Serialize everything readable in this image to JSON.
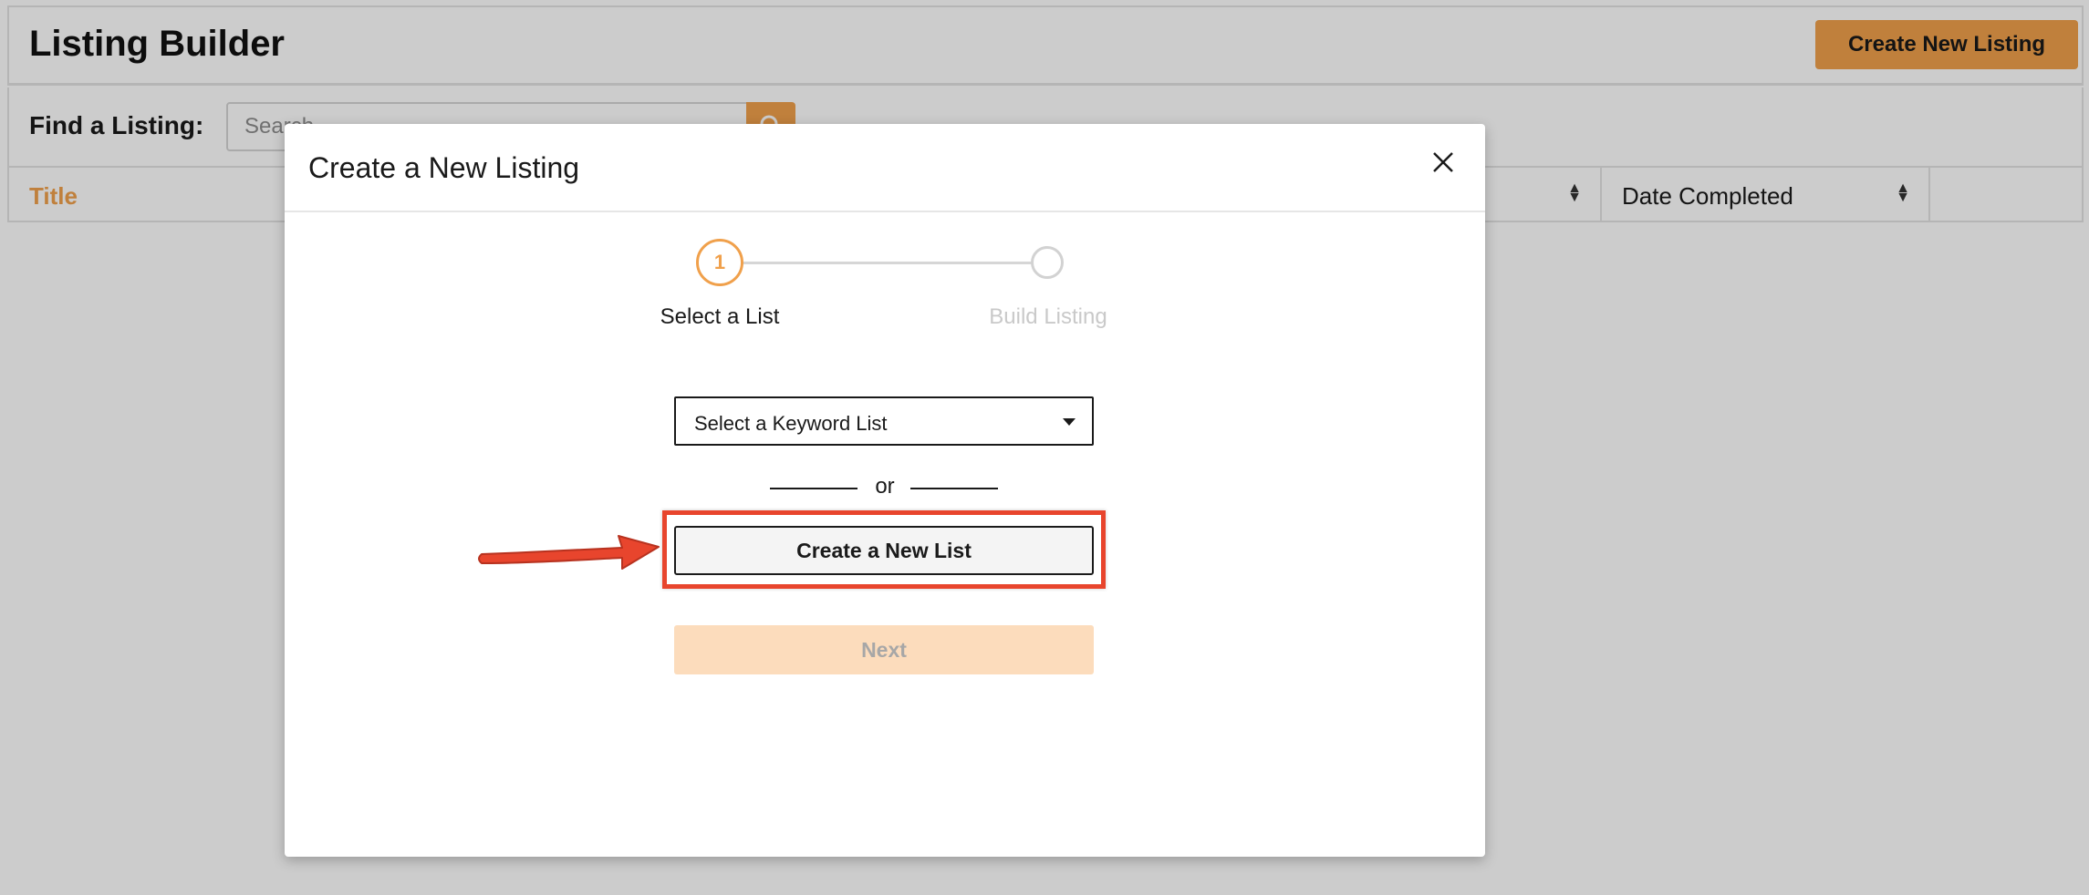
{
  "page": {
    "title": "Listing Builder",
    "create_button": "Create New Listing",
    "search": {
      "label": "Find a Listing:",
      "placeholder": "Search"
    },
    "table": {
      "columns": [
        "Title",
        "",
        "Date Completed",
        ""
      ]
    }
  },
  "modal": {
    "title": "Create a New Listing",
    "steps": [
      {
        "number": "1",
        "label": "Select a List",
        "active": true
      },
      {
        "number": "",
        "label": "Build Listing",
        "active": false
      }
    ],
    "keyword_select": {
      "value": "Select a Keyword List"
    },
    "divider_text": "or",
    "create_list_button": "Create a New List",
    "next_button": "Next"
  },
  "colors": {
    "accent": "#f0a04b",
    "annotation": "#e8452d"
  },
  "icons": {
    "search": "search-icon",
    "close": "close-icon",
    "sort": "sort-icon",
    "dropdown": "chevron-down-icon",
    "annotation_arrow": "arrow-right-icon"
  }
}
